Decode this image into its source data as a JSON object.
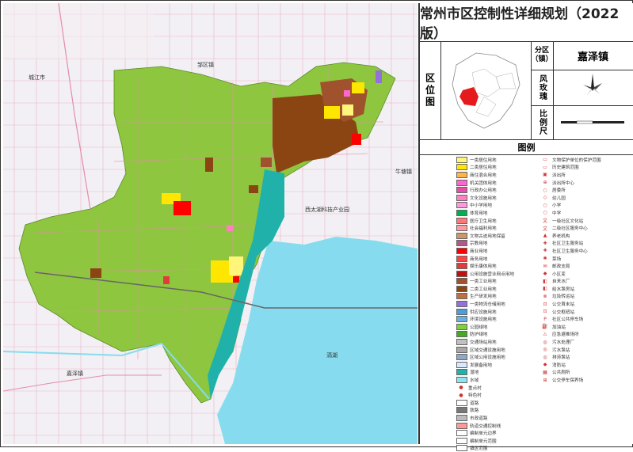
{
  "title": "常州市区控制性详细规划（2022版）",
  "header": {
    "location_label": "区位图",
    "district_label": "分区（镇）",
    "district_value": "嘉泽镇",
    "rose_label": "风玫瑰",
    "scale_label": "比例尺"
  },
  "legend": {
    "title": "图例",
    "left": [
      {
        "label": "一类居住用地",
        "color": "#fff57a"
      },
      {
        "label": "二类居住用地",
        "color": "#ffe600"
      },
      {
        "label": "商住混合用地",
        "color": "#ffb347"
      },
      {
        "label": "机关团体用地",
        "color": "#ff66cc"
      },
      {
        "label": "行政办公用地",
        "color": "#e64da6"
      },
      {
        "label": "文化设施用地",
        "color": "#ff80c0"
      },
      {
        "label": "中小学用地",
        "color": "#ff99dd"
      },
      {
        "label": "体育用地",
        "color": "#00b050"
      },
      {
        "label": "医疗卫生用地",
        "color": "#ff7777"
      },
      {
        "label": "社会福利用地",
        "color": "#ff9aa2"
      },
      {
        "label": "文物古迹用地保留",
        "color": "#cc9966"
      },
      {
        "label": "宗教用地",
        "color": "#b05a8c"
      },
      {
        "label": "商业用地",
        "color": "#ff0000"
      },
      {
        "label": "商务用地",
        "color": "#ff4444"
      },
      {
        "label": "娱乐康体用地",
        "color": "#e03c3c"
      },
      {
        "label": "公用设施营业网点用地",
        "color": "#c01010"
      },
      {
        "label": "一类工业用地",
        "color": "#a0522d"
      },
      {
        "label": "二类工业用地",
        "color": "#8b4513"
      },
      {
        "label": "生产研发用地",
        "color": "#bf7040"
      },
      {
        "label": "一类物流仓储用地",
        "color": "#9370db"
      },
      {
        "label": "供应设施用地",
        "color": "#4c9ed9"
      },
      {
        "label": "环境设施用地",
        "color": "#6bb0e0"
      },
      {
        "label": "公园绿地",
        "color": "#7fd13b"
      },
      {
        "label": "防护绿地",
        "color": "#44aa22"
      },
      {
        "label": "交通场站用地",
        "color": "#c0c0c0"
      },
      {
        "label": "区域交通设施用地",
        "color": "#a8a8a8"
      },
      {
        "label": "区域公用设施用地",
        "color": "#8fa8c8"
      },
      {
        "label": "发展备用地",
        "color": "#d8e8ff"
      },
      {
        "label": "湿地",
        "color": "#20b2aa"
      },
      {
        "label": "水域",
        "color": "#8fe3f0"
      },
      {
        "label": "重点村",
        "color": "#ffffff",
        "icon": "●"
      },
      {
        "label": "特色村",
        "color": "#ffffff",
        "icon": "●"
      },
      {
        "label": "道路",
        "color": "#ffffff"
      },
      {
        "label": "铁路",
        "color": "#777777"
      },
      {
        "label": "市政道路",
        "color": "#bbbbbb"
      },
      {
        "label": "轨道交通控制线",
        "color": "#ff9999"
      },
      {
        "label": "编制单元边界",
        "color": "#ffffff"
      },
      {
        "label": "编制单元范围",
        "color": "#ffffff"
      },
      {
        "label": "镇区范围",
        "color": "#ffffff"
      }
    ],
    "right": [
      {
        "label": "文物保护单位的保护范围",
        "icon": "▭"
      },
      {
        "label": "历史建筑范围",
        "icon": "▭"
      },
      {
        "label": "派出所",
        "icon": "▣"
      },
      {
        "label": "派出所中心",
        "icon": "⊕"
      },
      {
        "label": "居委所",
        "icon": "○"
      },
      {
        "label": "幼儿园",
        "icon": "◇"
      },
      {
        "label": "小学",
        "icon": "○"
      },
      {
        "label": "中学",
        "icon": "○"
      },
      {
        "label": "一级社区文化站",
        "icon": "文"
      },
      {
        "label": "二级社区服务中心",
        "icon": "文"
      },
      {
        "label": "养老机构",
        "icon": "▲"
      },
      {
        "label": "社区卫生服务站",
        "icon": "✚"
      },
      {
        "label": "社区卫生服务中心",
        "icon": "✚"
      },
      {
        "label": "菜场",
        "icon": "✱"
      },
      {
        "label": "邮政支局",
        "icon": "✉"
      },
      {
        "label": "小区变",
        "icon": "◆"
      },
      {
        "label": "自来水厂",
        "icon": "◧"
      },
      {
        "label": "给水泵房站",
        "icon": "◧"
      },
      {
        "label": "垃圾转运站",
        "icon": "⊗"
      },
      {
        "label": "公交首末站",
        "icon": "⊡"
      },
      {
        "label": "公交枢纽站",
        "icon": "⊡"
      },
      {
        "label": "社区公共停车场",
        "icon": "P"
      },
      {
        "label": "加油站",
        "icon": "⛽"
      },
      {
        "label": "应急避难场所",
        "icon": "⚠"
      },
      {
        "label": "污水处理厂",
        "icon": "◎"
      },
      {
        "label": "污水泵站",
        "icon": "◎"
      },
      {
        "label": "排涝泵站",
        "icon": "◎"
      },
      {
        "label": "消防站",
        "icon": "◆"
      },
      {
        "label": "公共厕所",
        "icon": "▦"
      },
      {
        "label": "公交停车保养场",
        "icon": "⊞"
      }
    ]
  },
  "map_labels": {
    "label_1": "城江市",
    "label_2": "牛塘镇",
    "label_3": "西太湖科技产业园",
    "label_4": "滆湖",
    "label_5": "邹区镇",
    "label_6": "嘉泽镇"
  }
}
